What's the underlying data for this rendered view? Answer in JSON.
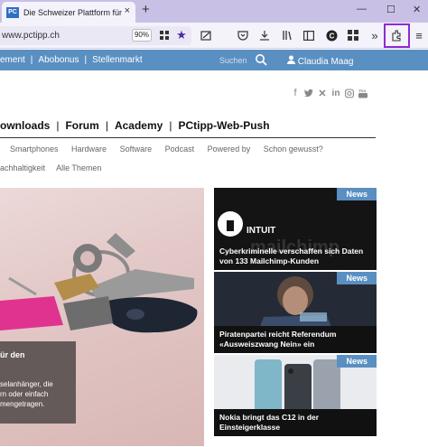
{
  "browser": {
    "tab_title": "Die Schweizer Plattform für Co",
    "tab_close": "×",
    "newtab": "+",
    "url": "www.pctipp.ch",
    "zoom": "90%",
    "win_minimize": "—",
    "win_maximize": "☐",
    "win_close": "✕"
  },
  "site": {
    "topnav": [
      "ement",
      "Abobonus",
      "Stellenmarkt"
    ],
    "search_placeholder": "Suchen",
    "user_name": "Claudia Maag",
    "mainnav": [
      "ownloads",
      "Forum",
      "Academy",
      "PCtipp-Web-Push"
    ],
    "subnav1": [
      "Smartphones",
      "Hardware",
      "Software",
      "Podcast",
      "Powered by",
      "Schon gewusst?"
    ],
    "subnav2": [
      "achhaltigkeit",
      "Alle Themen"
    ],
    "hero": {
      "heading": "ür den",
      "text": "selanhänger, die\nrn oder einfach\nmengetragen."
    },
    "cards": [
      {
        "badge": "News",
        "caption": "Cyberkriminelle verschaffen sich Daten von 133 Mailchimp-Kunden",
        "image_text": "INTUIT"
      },
      {
        "badge": "News",
        "caption": "Piratenpartei reicht Referendum «Ausweiszwang Nein» ein"
      },
      {
        "badge": "News",
        "caption": "Nokia bringt das C12 in der Einsteigerklasse"
      }
    ]
  },
  "colors": {
    "header_blue": "#5a8fc2",
    "tab_bar": "#c9c0e6",
    "highlight": "#8e2bd0"
  }
}
